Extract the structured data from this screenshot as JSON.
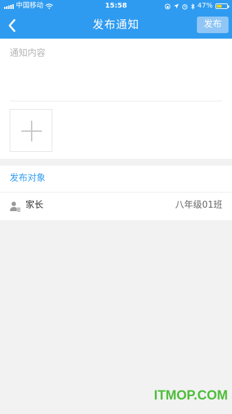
{
  "status_bar": {
    "carrier": "中国移动",
    "time": "15:58",
    "battery_percent": "47%"
  },
  "nav": {
    "title": "发布通知",
    "publish_label": "发布"
  },
  "notice": {
    "placeholder": "通知内容"
  },
  "target": {
    "header": "发布对象",
    "row_label": "家长",
    "row_value": "八年级01班"
  },
  "watermark": "ITMOP.COM",
  "colors": {
    "primary": "#2f9bf0",
    "publish_button": "#8fc6f5",
    "watermark": "#4dbd3a"
  }
}
